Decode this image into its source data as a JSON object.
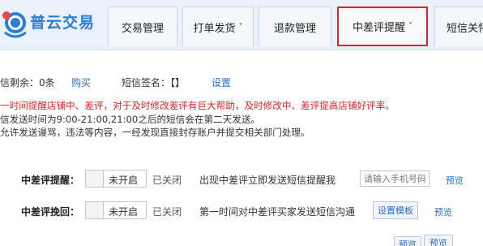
{
  "header": {
    "logo_text": "普云交易",
    "tabs": [
      {
        "label": "交易管理",
        "has_dropdown": false,
        "active": false
      },
      {
        "label": "打单发货",
        "has_dropdown": true,
        "active": false
      },
      {
        "label": "退款管理",
        "has_dropdown": false,
        "active": false
      },
      {
        "label": "中差评提醒",
        "has_dropdown": true,
        "active": true
      },
      {
        "label": "短信关怀",
        "has_dropdown": false,
        "active": false
      }
    ],
    "chevron": "˅"
  },
  "sms_info": {
    "remaining_label": "信剩余：0条",
    "buy_link": "购买",
    "signature_label": "短信签名：【】",
    "settings_link": "设置"
  },
  "notices": {
    "red_line": "一时间提醒店铺中、差评，对于及时修改差评有巨大帮助，及时修改中、差评提高店铺好评率。",
    "line2": "信发送时间为9:00-21:00,21:00之后的短信会在第二天发送。",
    "line3": "允许发送谩骂，违法等内容，一经发现直接封存账户并提交相关部门处理。"
  },
  "rows": [
    {
      "label": "中差评提醒：",
      "toggle_text": "未开启",
      "status": "已关闭",
      "description": "出现中差评立即发送短信提醒我",
      "input_placeholder": "请输入手机号码",
      "preview_link": "预览"
    },
    {
      "label": "中差评挽回：",
      "toggle_text": "未开启",
      "status": "已关闭",
      "description": "第一时间对中差评买家发送短信沟通",
      "template_button": "设置模板",
      "preview_link": "预览"
    }
  ],
  "bottom_links": [
    "预览",
    "预览"
  ],
  "colors": {
    "accent": "#2a7ed6",
    "warning": "#d9252a",
    "header_bg": "#e9f1fa"
  }
}
